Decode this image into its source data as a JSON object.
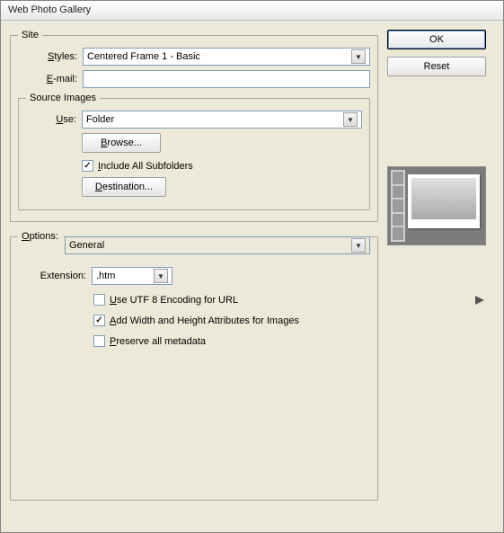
{
  "window": {
    "title": "Web Photo Gallery"
  },
  "buttons": {
    "ok": "OK",
    "reset": "Reset",
    "browse": "Browse...",
    "destination": "Destination..."
  },
  "site": {
    "legend": "Site",
    "styles_label": "Styles:",
    "styles_value": "Centered Frame 1 - Basic",
    "email_label": "E-mail:",
    "email_value": ""
  },
  "source": {
    "legend": "Source Images",
    "use_label": "Use:",
    "use_value": "Folder",
    "include_subfolders": "Include All Subfolders",
    "include_subfolders_checked": true
  },
  "options": {
    "legend": "Options:",
    "value": "General",
    "extension_label": "Extension:",
    "extension_value": ".htm",
    "utf8": "Use UTF 8 Encoding for URL",
    "utf8_checked": false,
    "addwh": "Add Width and Height Attributes for Images",
    "addwh_checked": true,
    "preserve": "Preserve all metadata",
    "preserve_checked": false
  },
  "labels_underline": {
    "styles": "S",
    "email": "E",
    "use": "U",
    "include": "I",
    "destination": "D",
    "options": "O",
    "browse": "B",
    "utf8": "U",
    "addwh": "A",
    "preserve": "P"
  }
}
